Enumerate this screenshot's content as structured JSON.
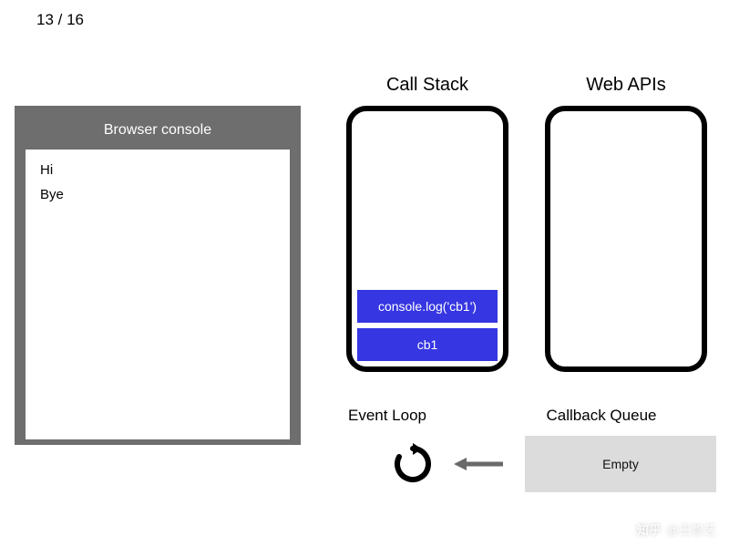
{
  "page": {
    "current": 13,
    "total": 16,
    "display": "13 / 16"
  },
  "console": {
    "title": "Browser console",
    "lines": [
      "Hi",
      "Bye"
    ]
  },
  "callstack": {
    "title": "Call Stack",
    "items": [
      "console.log('cb1')",
      "cb1"
    ]
  },
  "webapis": {
    "title": "Web APIs",
    "items": []
  },
  "eventloop": {
    "title": "Event Loop"
  },
  "callbackQueue": {
    "title": "Callback Queue",
    "status": "Empty",
    "items": []
  },
  "watermark": {
    "platform": "知乎",
    "user": "@王智艺"
  },
  "colors": {
    "stack_item_bg": "#3636e2",
    "console_chrome": "#6e6e6e",
    "queue_bg": "#dcdcdc"
  },
  "icons": {
    "event_loop": "refresh-loop-icon",
    "queue_arrow": "arrow-left-icon"
  }
}
